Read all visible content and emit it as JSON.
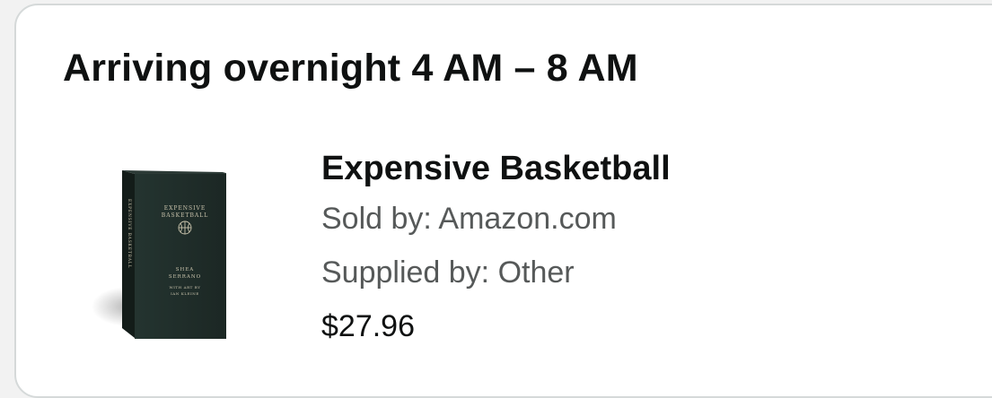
{
  "delivery": {
    "heading": "Arriving overnight 4 AM – 8 AM"
  },
  "item": {
    "title": "Expensive Basketball",
    "sold_by": "Sold by: Amazon.com",
    "supplied_by": "Supplied by: Other",
    "price": "$27.96",
    "cover": {
      "title_line1": "EXPENSIVE",
      "title_line2": "BASKETBALL",
      "author_line1": "SHEA",
      "author_line2": "SERRANO",
      "credit_line1": "WITH ART BY",
      "credit_line2": "IAN KLEINE",
      "spine_text": "EXPENSIVE BASKETBALL"
    }
  },
  "colors": {
    "text": "#0f1111",
    "secondary_text": "#565959",
    "book_cover": "#1f2b27",
    "book_print": "#c9c3ac"
  }
}
